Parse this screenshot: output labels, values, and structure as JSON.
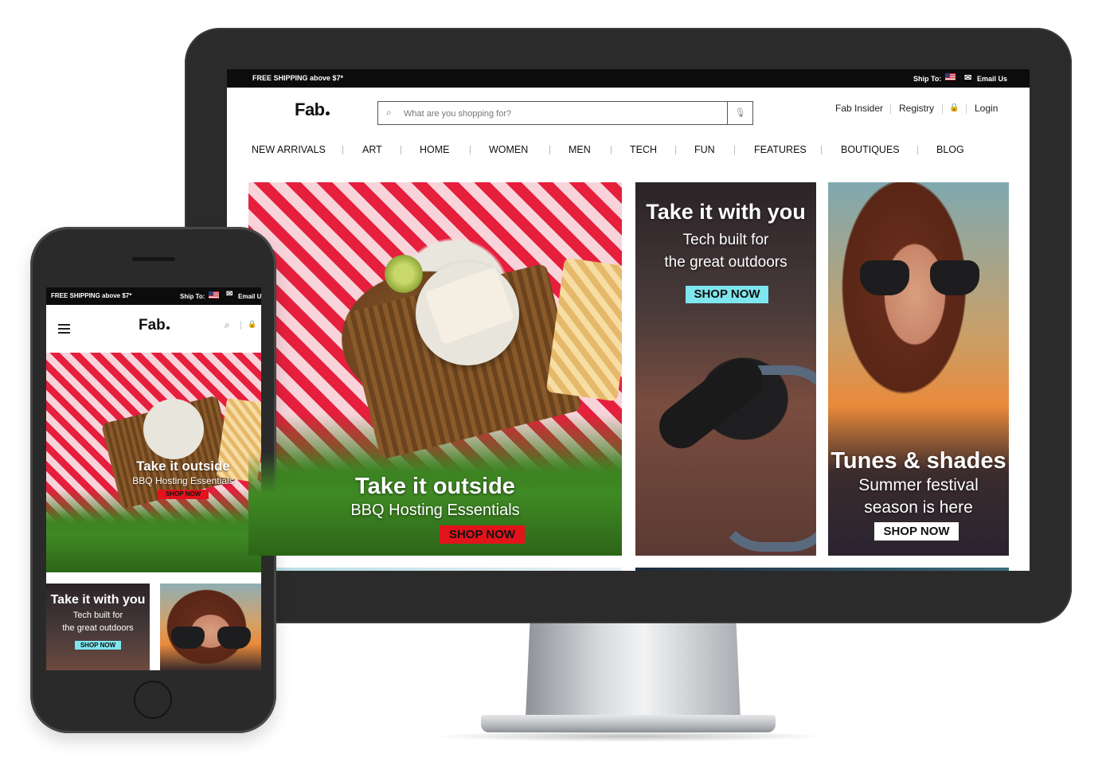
{
  "desktop": {
    "topbar": {
      "promo": "FREE SHIPPING above $7*",
      "ship_to": "Ship To:",
      "email_us": "Email Us"
    },
    "header": {
      "logo": "Fab",
      "search_placeholder": "What are you shopping for?",
      "links": {
        "insider": "Fab Insider",
        "registry": "Registry",
        "login": "Login"
      }
    },
    "nav": [
      "NEW ARRIVALS",
      "ART",
      "HOME",
      "WOMEN",
      "MEN",
      "TECH",
      "FUN",
      "FEATURES",
      "BOUTIQUES",
      "BLOG"
    ],
    "tiles": {
      "picnic": {
        "title": "Take it outside",
        "subtitle": "BBQ Hosting Essentials",
        "cta": "SHOP NOW"
      },
      "bike": {
        "title": "Take it with you",
        "subtitle_line1": "Tech built for",
        "subtitle_line2": "the great outdoors",
        "cta": "SHOP NOW"
      },
      "shades": {
        "title": "Tunes & shades",
        "subtitle_line1": "Summer festival",
        "subtitle_line2": "season is here",
        "cta": "SHOP NOW"
      }
    }
  },
  "mobile": {
    "topbar": {
      "promo": "FREE SHIPPING above $7*",
      "ship_to": "Ship To:",
      "email_us": "Email Us"
    },
    "logo": "Fab",
    "tiles": {
      "picnic": {
        "title": "Take it outside",
        "subtitle": "BBQ Hosting Essentials",
        "cta": "SHOP NOW"
      },
      "bike": {
        "title": "Take it with you",
        "subtitle_line1": "Tech built for",
        "subtitle_line2": "the great outdoors",
        "cta": "SHOP NOW"
      }
    }
  },
  "colors": {
    "topbar": "#0c0c0c",
    "cta_red": "#e3131b",
    "cta_cyan": "#7ee6ee",
    "cta_white": "#ffffff",
    "device_frame": "#2b2b2b"
  },
  "icons": [
    "search-icon",
    "microphone-icon",
    "lock-icon",
    "us-flag-icon",
    "mail-icon",
    "hamburger-menu-icon"
  ]
}
